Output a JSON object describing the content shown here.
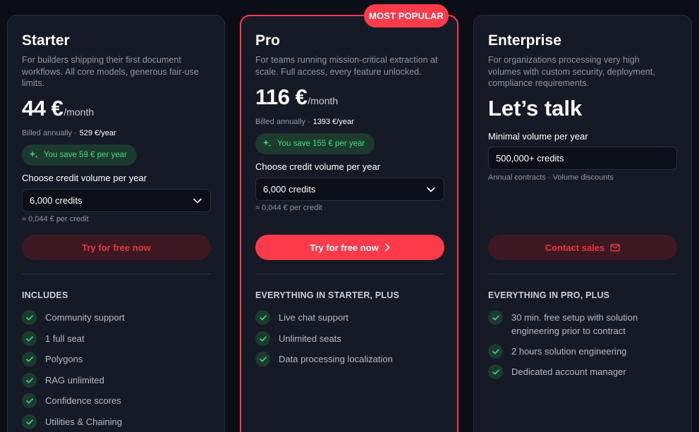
{
  "badge": "MOST POPULAR",
  "starter": {
    "title": "Starter",
    "description": "For builders shipping their first document workflows. All core models, generous fair-use limits.",
    "price": "44 €",
    "period": "/month",
    "billed_label": "Billed annually ·",
    "billed_amount": "529 €/year",
    "savings": "You save 59 € per year",
    "volume_label": "Choose credit volume per year",
    "volume_value": "6,000 credits",
    "per_credit": "≈ 0,044 € per credit",
    "cta": "Try for free now",
    "features_heading": "INCLUDES",
    "features": [
      "Community support",
      "1 full seat",
      "Polygons",
      "RAG unlimited",
      "Confidence scores",
      "Utilities & Chaining"
    ]
  },
  "pro": {
    "title": "Pro",
    "description": "For teams running mission-critical extraction at scale. Full access, every feature unlocked.",
    "price": "116 €",
    "period": "/month",
    "billed_label": "Billed annually ·",
    "billed_amount": "1393 €/year",
    "savings": "You save 155 € per year",
    "volume_label": "Choose credit volume per year",
    "volume_value": "6,000 credits",
    "per_credit": "≈ 0,044 € per credit",
    "cta": "Try for free now",
    "features_heading": "EVERYTHING IN STARTER, PLUS",
    "features": [
      "Live chat support",
      "Unlimited seats",
      "Data processing localization"
    ]
  },
  "enterprise": {
    "title": "Enterprise",
    "description": "For organizations processing very high volumes with custom security, deployment, compliance requirements.",
    "price_text": "Let’s talk",
    "volume_label": "Minimal volume per year",
    "volume_value": "500,000+ credits",
    "contract_note": "Annual contracts · Volume discounts",
    "cta": "Contact sales",
    "features_heading": "EVERYTHING IN PRO, PLUS",
    "features": [
      "30 min. free setup with solution engineering prior to contract",
      "2 hours solution engineering",
      "Dedicated account manager"
    ]
  },
  "colors": {
    "accent": "#ff3a4a",
    "success": "#3ddc84",
    "card": "#151a26",
    "background": "#0b0e17"
  },
  "icons": {
    "savings": "sparkle-icon",
    "select": "chevron-down-icon",
    "cta_pro": "chevron-right-icon",
    "cta_enterprise": "mail-icon",
    "feature": "check-icon"
  }
}
